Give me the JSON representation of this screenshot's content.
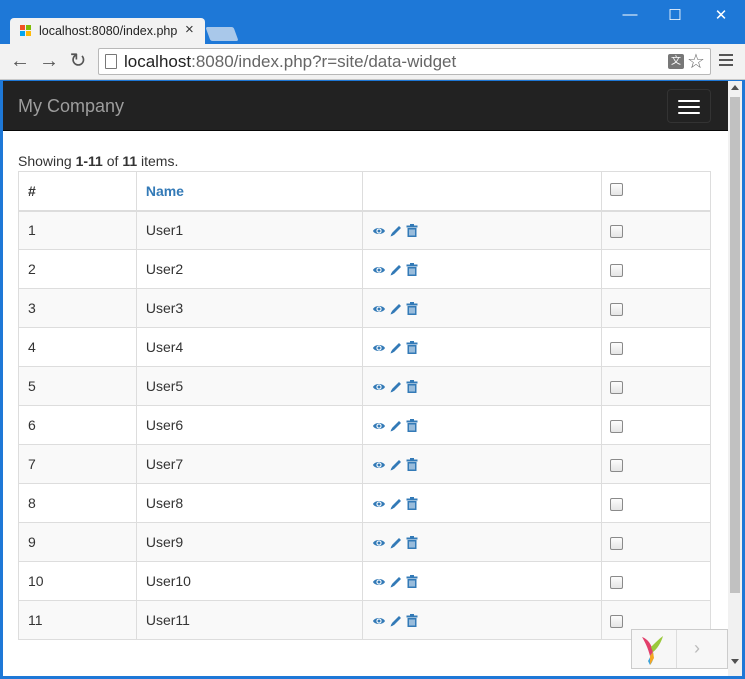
{
  "browser": {
    "tab_title": "localhost:8080/index.php",
    "tab_close": "×",
    "url_host": "localhost",
    "url_rest": ":8080/index.php?r=site/data-widget",
    "translate_glyph": "文",
    "star_glyph": "☆",
    "window_controls": {
      "minimize": "—",
      "maximize": "☐",
      "close": "✕"
    },
    "nav": {
      "back": "←",
      "forward": "→",
      "reload": "↻"
    }
  },
  "app": {
    "brand": "My Company"
  },
  "grid": {
    "summary": {
      "prefix": "Showing ",
      "range": "1-11",
      "of": " of ",
      "total": "11",
      "suffix": " items."
    },
    "headers": {
      "num": "#",
      "name": "Name"
    },
    "rows": [
      {
        "num": "1",
        "name": "User1"
      },
      {
        "num": "2",
        "name": "User2"
      },
      {
        "num": "3",
        "name": "User3"
      },
      {
        "num": "4",
        "name": "User4"
      },
      {
        "num": "5",
        "name": "User5"
      },
      {
        "num": "6",
        "name": "User6"
      },
      {
        "num": "7",
        "name": "User7"
      },
      {
        "num": "8",
        "name": "User8"
      },
      {
        "num": "9",
        "name": "User9"
      },
      {
        "num": "10",
        "name": "User10"
      },
      {
        "num": "11",
        "name": "User11"
      }
    ],
    "action_icons": [
      "eye-icon",
      "pencil-icon",
      "trash-icon"
    ]
  },
  "debug": {
    "toggle_glyph": "›"
  },
  "colors": {
    "link": "#337ab7",
    "navbar": "#222222",
    "chrome": "#1e78d7"
  }
}
